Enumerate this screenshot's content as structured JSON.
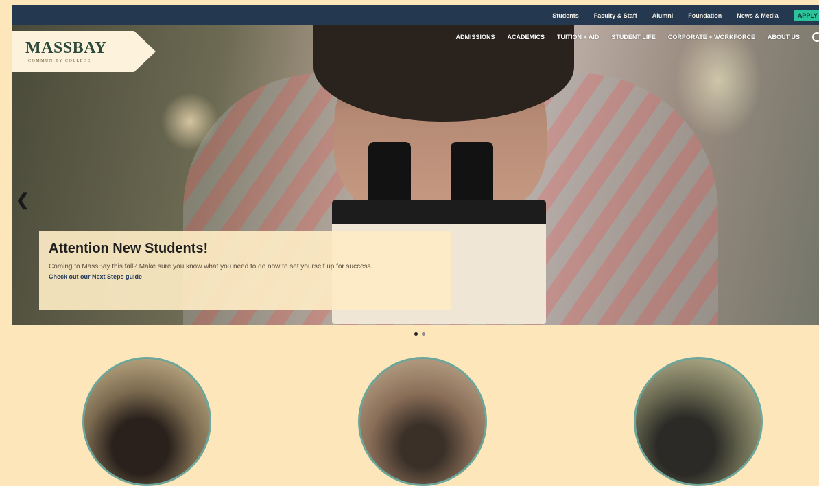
{
  "topbar": {
    "links": [
      "Students",
      "Faculty & Staff",
      "Alumni",
      "Foundation",
      "News & Media"
    ],
    "apply_label": "APPLY"
  },
  "logo": {
    "name": "MASSBAY",
    "sub": "COMMUNITY COLLEGE"
  },
  "mainnav": {
    "items": [
      "ADMISSIONS",
      "ACADEMICS",
      "TUITION + AID",
      "STUDENT LIFE",
      "CORPORATE + WORKFORCE",
      "ABOUT US"
    ]
  },
  "hero": {
    "title": "Attention New Students!",
    "body": "Coming to MassBay this fall? Make sure you know what you need to do now to set yourself up for success.",
    "link": "Check out our Next Steps guide",
    "slide_count": 2,
    "active_slide": 1
  },
  "icons": {
    "prev": "chevron-left-icon",
    "search": "search-icon"
  },
  "colors": {
    "topbar_bg": "#243850",
    "apply_bg": "#2bc49a",
    "page_bg": "#fde6b9"
  }
}
